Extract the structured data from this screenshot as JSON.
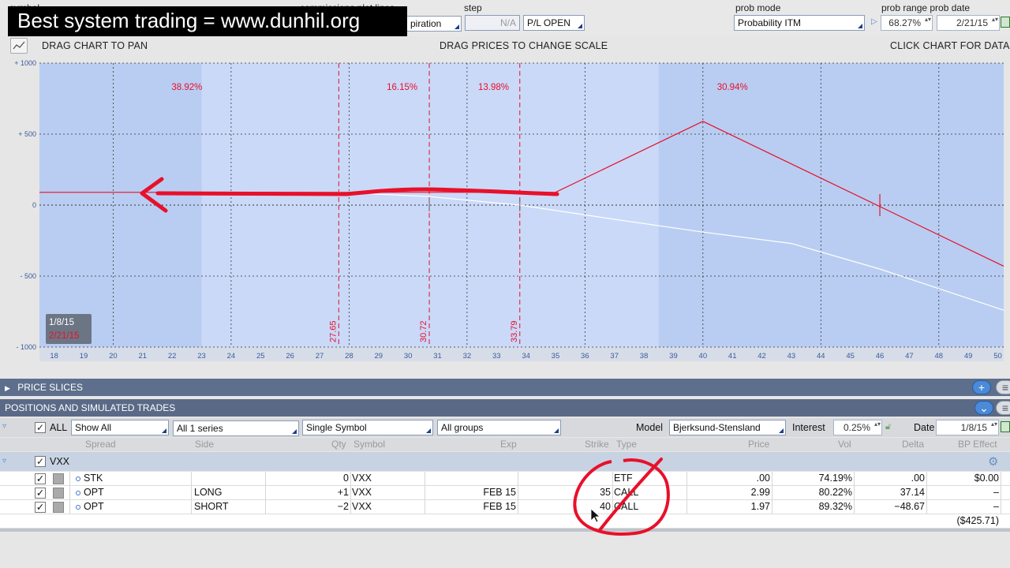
{
  "top": {
    "symbol_label": "symbol",
    "commissions_label": "commissions plot lines",
    "expiration_value": "piration",
    "step_label": "step",
    "step_value": "N/A",
    "pl_value": "P/L OPEN",
    "prob_mode_label": "prob mode",
    "prob_mode_value": "Probability ITM",
    "prob_range_label": "prob range prob date",
    "prob_range_value": "68.27%",
    "prob_date_value": "2/21/15"
  },
  "banner": "Best system trading = www.dunhil.org",
  "hints": {
    "drag_chart": "DRAG CHART TO PAN",
    "drag_prices": "DRAG PRICES TO CHANGE SCALE",
    "click_chart": "CLICK CHART FOR DATA"
  },
  "chart_data": {
    "type": "line",
    "x_ticks": [
      "18",
      "19",
      "20",
      "21",
      "22",
      "23",
      "24",
      "25",
      "26",
      "27",
      "28",
      "29",
      "30",
      "31",
      "32",
      "33",
      "34",
      "35",
      "36",
      "37",
      "38",
      "39",
      "40",
      "41",
      "42",
      "43",
      "44",
      "45",
      "46",
      "47",
      "48",
      "49",
      "50"
    ],
    "y_ticks": [
      "+ 1000",
      "+ 500",
      "0",
      "- 500",
      "- 1000"
    ],
    "ylim": [
      -1000,
      1000
    ],
    "xlim": [
      17.5,
      50.2
    ],
    "probabilities": [
      "38.92%",
      "16.15%",
      "13.98%",
      "30.94%"
    ],
    "price_slices": [
      "27.65",
      "30.72",
      "33.79"
    ],
    "date_box": [
      "1/8/15",
      "2/21/15"
    ],
    "series": [
      {
        "color": "#e8102a",
        "points": [
          [
            17.5,
            90
          ],
          [
            35,
            90
          ],
          [
            40,
            590
          ],
          [
            50.2,
            -430
          ]
        ]
      },
      {
        "color": "#ffffff",
        "points": [
          [
            27.65,
            90
          ],
          [
            30.72,
            60
          ],
          [
            33.79,
            0
          ],
          [
            37,
            -100
          ],
          [
            40,
            -190
          ],
          [
            43,
            -270
          ],
          [
            46,
            -450
          ],
          [
            50.2,
            -740
          ]
        ]
      }
    ]
  },
  "sections": {
    "price_slices": "PRICE SLICES",
    "positions": "POSITIONS AND SIMULATED TRADES"
  },
  "filters": {
    "all_label": "ALL",
    "show": "Show All",
    "series": "All 1 series",
    "symbol_mode": "Single Symbol",
    "groups": "All groups",
    "model_label": "Model",
    "model": "Bjerksund-Stensland",
    "interest_label": "Interest",
    "interest": "0.25%",
    "date_label": "Date",
    "date": "1/8/15"
  },
  "columns": {
    "spread": "Spread",
    "side": "Side",
    "qty": "Qty",
    "symbol": "Symbol",
    "exp": "Exp",
    "strike": "Strike",
    "type": "Type",
    "price": "Price",
    "vol": "Vol",
    "delta": "Delta",
    "bp": "BP Effect"
  },
  "group": {
    "name": "VXX"
  },
  "rows": [
    {
      "spread": "STK",
      "side": "",
      "qty": "0",
      "symbol": "VXX",
      "exp": "",
      "strike": "",
      "type": "ETF",
      "price": ".00",
      "vol": "74.19%",
      "delta": ".00",
      "bp": "$0.00"
    },
    {
      "spread": "OPT",
      "side": "LONG",
      "qty": "+1",
      "symbol": "VXX",
      "exp": "FEB 15",
      "strike": "35",
      "type": "CALL",
      "price": "2.99",
      "vol": "80.22%",
      "delta": "37.14",
      "bp": "–"
    },
    {
      "spread": "OPT",
      "side": "SHORT",
      "qty": "−2",
      "symbol": "VXX",
      "exp": "FEB 15",
      "strike": "40",
      "type": "CALL",
      "price": "1.97",
      "vol": "89.32%",
      "delta": "−48.67",
      "bp": "–"
    }
  ],
  "total_bp": "($425.71)",
  "colors": {
    "accent": "#e8102a",
    "chart_bg": "#c9d8f7",
    "header": "#5d6f8c"
  }
}
